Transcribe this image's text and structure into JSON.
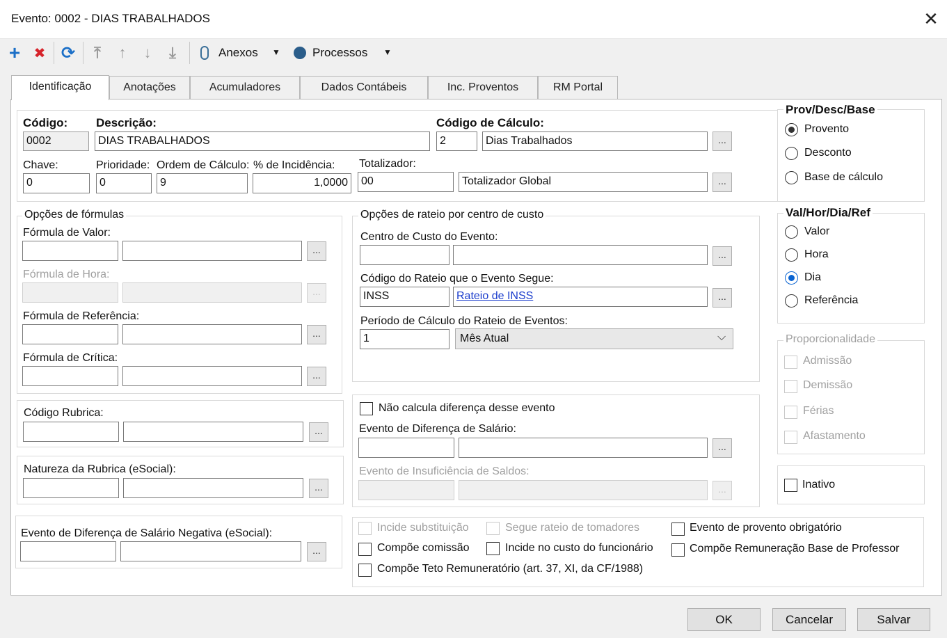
{
  "window": {
    "title": "Evento: 0002 - DIAS TRABALHADOS",
    "close_glyph": "✕"
  },
  "toolbar": {
    "add_icon": "+",
    "delete_icon": "✖",
    "refresh_icon": "⟳",
    "first_icon": "⤒",
    "up_icon": "↑",
    "down_icon": "↓",
    "last_icon": "⤓",
    "attachments_label": "Anexos",
    "processes_label": "Processos",
    "dropdown_glyph": "▼",
    "colors": {
      "add": "#1b6fc7",
      "delete": "#d6232a",
      "refresh": "#1b6fc7",
      "disabled": "#9a9a9a"
    }
  },
  "tabs": [
    {
      "label": "Identificação"
    },
    {
      "label": "Anotações"
    },
    {
      "label": "Acumuladores"
    },
    {
      "label": "Dados Contábeis"
    },
    {
      "label": "Inc. Proventos"
    },
    {
      "label": "RM Portal"
    }
  ],
  "ident": {
    "codigo_label": "Código:",
    "codigo_value": "0002",
    "descricao_label": "Descrição:",
    "descricao_value": "DIAS TRABALHADOS",
    "codcalc_label": "Código de Cálculo:",
    "codcalc_value": "2",
    "codcalc_desc": "Dias Trabalhados",
    "chave_label": "Chave:",
    "chave_value": "0",
    "prioridade_label": "Prioridade:",
    "prioridade_value": "0",
    "ordem_label": "Ordem de Cálculo:",
    "ordem_value": "9",
    "incidencia_label": "% de Incidência:",
    "incidencia_value": "1,0000",
    "totalizador_label": "Totalizador:",
    "totalizador_value": "00",
    "totalizador_desc": "Totalizador Global",
    "lookup_glyph": "..."
  },
  "formulas": {
    "title": "Opções de fórmulas",
    "valor_label": "Fórmula de Valor:",
    "hora_label": "Fórmula de Hora:",
    "referencia_label": "Fórmula de Referência:",
    "critica_label": "Fórmula de Crítica:"
  },
  "rubrica": {
    "codigo_label": "Código Rubrica:",
    "natureza_label": "Natureza da Rubrica (eSocial):",
    "diferenca_negativa_label": "Evento de Diferença de Salário Negativa (eSocial):"
  },
  "rateio": {
    "title": "Opções de rateio por centro de custo",
    "centro_label": "Centro de Custo do Evento:",
    "codigo_label": "Código do Rateio que o Evento Segue:",
    "codigo_value": "INSS",
    "codigo_link": "Rateio de INSS",
    "periodo_label": "Período de Cálculo do Rateio de Eventos:",
    "periodo_value": "1",
    "periodo_select": "Mês Atual",
    "select_arrow": "⌵"
  },
  "diferenca": {
    "nao_calcula_label": "Não calcula diferença desse evento",
    "evento_dif_label": "Evento de Diferença de Salário:",
    "insuficiencia_label": "Evento de Insuficiência de Saldos:"
  },
  "checks": {
    "incide_substituicao": "Incide substituição",
    "segue_rateio": "Segue rateio de tomadores",
    "provento_obrigatorio": "Evento de provento obrigatório",
    "compoe_comissao": "Compõe comissão",
    "incide_custo": "Incide no custo do funcionário",
    "compoe_remuneracao": "Compõe Remuneração Base de Professor",
    "compoe_teto": "Compõe Teto Remuneratório (art. 37, XI, da CF/1988)"
  },
  "prov_desc": {
    "title": "Prov/Desc/Base",
    "options": [
      "Provento",
      "Desconto",
      "Base de cálculo"
    ],
    "selected": "Provento"
  },
  "val_hor": {
    "title": "Val/Hor/Dia/Ref",
    "options": [
      "Valor",
      "Hora",
      "Dia",
      "Referência"
    ],
    "selected": "Dia",
    "accent": "#0a64d2"
  },
  "proporcionalidade": {
    "title": "Proporcionalidade",
    "options": [
      "Admissão",
      "Demissão",
      "Férias",
      "Afastamento"
    ]
  },
  "inativo_label": "Inativo",
  "buttons": {
    "ok": "OK",
    "cancel": "Cancelar",
    "save": "Salvar"
  }
}
